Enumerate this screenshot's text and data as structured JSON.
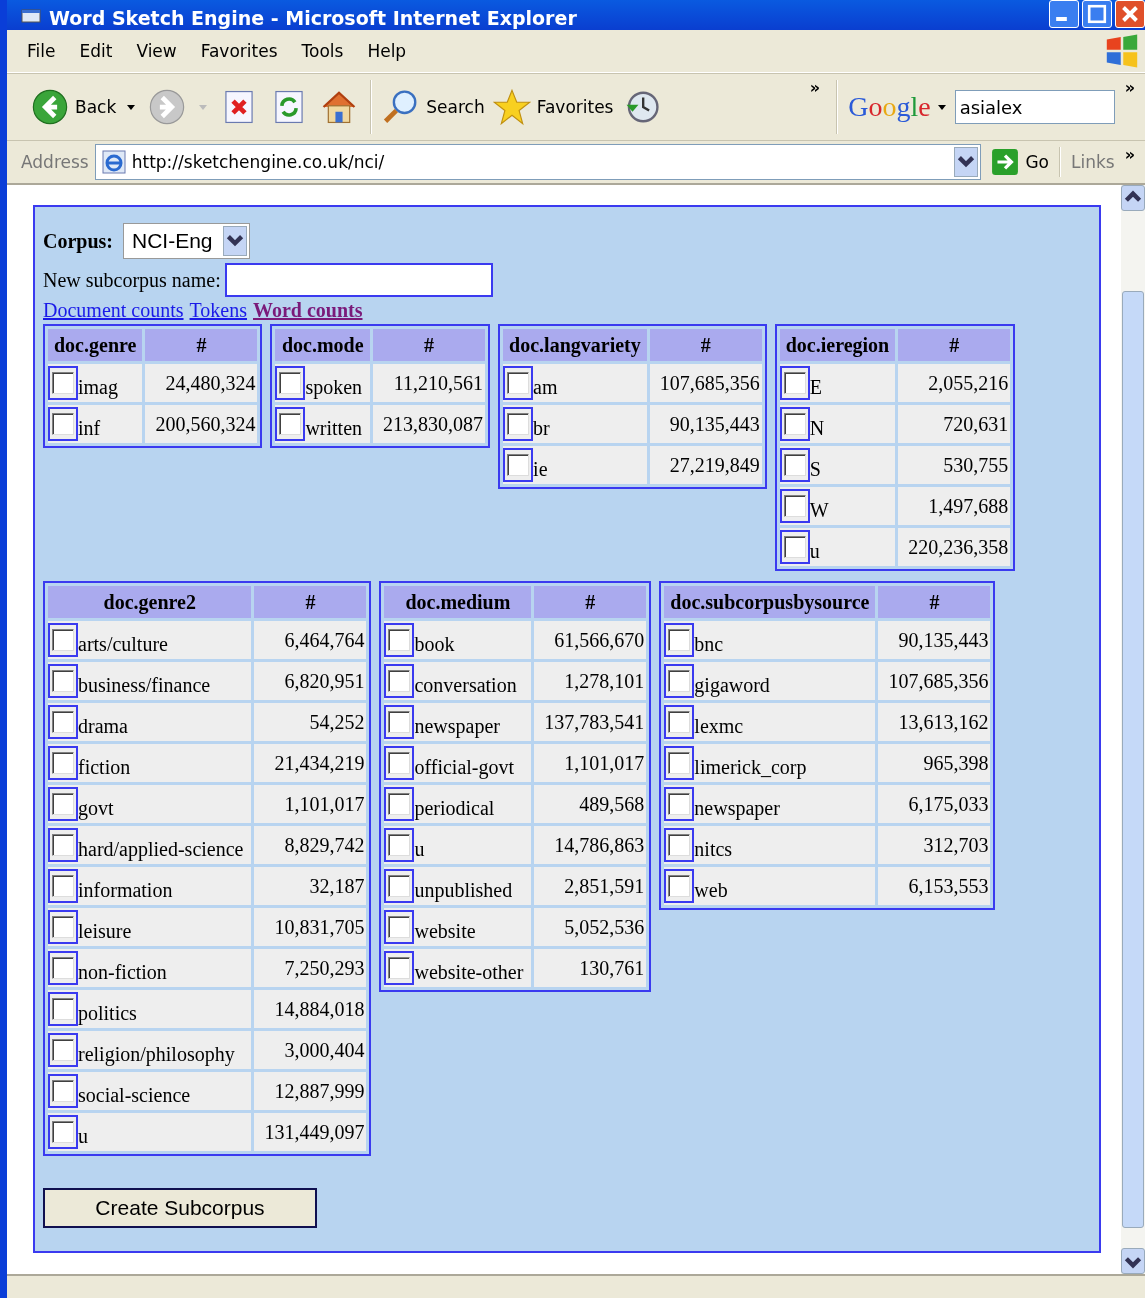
{
  "window": {
    "title": "Word Sketch Engine - Microsoft Internet Explorer"
  },
  "menu": [
    "File",
    "Edit",
    "View",
    "Favorites",
    "Tools",
    "Help"
  ],
  "toolbar": {
    "back": "Back",
    "search": "Search",
    "favorites": "Favorites",
    "overflow": "»",
    "google": "Google",
    "search_value": "asialex",
    "overflow_right": "»"
  },
  "address_bar": {
    "label": "Address",
    "url": "http://sketchengine.co.uk/nci/",
    "go": "Go",
    "links": "Links",
    "overflow": "»"
  },
  "form": {
    "corpus_label": "Corpus:",
    "corpus_value": "NCI-Eng",
    "name_label": "New subcorpus name:",
    "count_links": [
      {
        "label": "Document counts",
        "selected": false
      },
      {
        "label": "Tokens",
        "selected": false
      },
      {
        "label": "Word counts",
        "selected": true
      }
    ],
    "facet_rows": [
      [
        {
          "attribute": "doc.genre",
          "count_header": "#",
          "rows": [
            {
              "value": "imag",
              "count": "24,480,324",
              "checked": false
            },
            {
              "value": "inf",
              "count": "200,560,324",
              "checked": false
            }
          ]
        },
        {
          "attribute": "doc.mode",
          "count_header": "#",
          "rows": [
            {
              "value": "spoken",
              "count": "11,210,561",
              "checked": false
            },
            {
              "value": "written",
              "count": "213,830,087",
              "checked": false
            }
          ]
        },
        {
          "attribute": "doc.langvariety",
          "count_header": "#",
          "rows": [
            {
              "value": "am",
              "count": "107,685,356",
              "checked": false
            },
            {
              "value": "br",
              "count": "90,135,443",
              "checked": false
            },
            {
              "value": "ie",
              "count": "27,219,849",
              "checked": false
            }
          ]
        },
        {
          "attribute": "doc.ieregion",
          "count_header": "#",
          "rows": [
            {
              "value": "E",
              "count": "2,055,216",
              "checked": false
            },
            {
              "value": "N",
              "count": "720,631",
              "checked": false
            },
            {
              "value": "S",
              "count": "530,755",
              "checked": false
            },
            {
              "value": "W",
              "count": "1,497,688",
              "checked": false
            },
            {
              "value": "u",
              "count": "220,236,358",
              "checked": false
            }
          ]
        }
      ],
      [
        {
          "attribute": "doc.genre2",
          "count_header": "#",
          "rows": [
            {
              "value": "arts/culture",
              "count": "6,464,764",
              "checked": false
            },
            {
              "value": "business/finance",
              "count": "6,820,951",
              "checked": false
            },
            {
              "value": "drama",
              "count": "54,252",
              "checked": false
            },
            {
              "value": "fiction",
              "count": "21,434,219",
              "checked": false
            },
            {
              "value": "govt",
              "count": "1,101,017",
              "checked": false
            },
            {
              "value": "hard/applied-science",
              "count": "8,829,742",
              "checked": false
            },
            {
              "value": "information",
              "count": "32,187",
              "checked": false
            },
            {
              "value": "leisure",
              "count": "10,831,705",
              "checked": false
            },
            {
              "value": "non-fiction",
              "count": "7,250,293",
              "checked": false
            },
            {
              "value": "politics",
              "count": "14,884,018",
              "checked": false
            },
            {
              "value": "religion/philosophy",
              "count": "3,000,404",
              "checked": false
            },
            {
              "value": "social-science",
              "count": "12,887,999",
              "checked": false
            },
            {
              "value": "u",
              "count": "131,449,097",
              "checked": false
            }
          ]
        },
        {
          "attribute": "doc.medium",
          "count_header": "#",
          "rows": [
            {
              "value": "book",
              "count": "61,566,670",
              "checked": false
            },
            {
              "value": "conversation",
              "count": "1,278,101",
              "checked": false
            },
            {
              "value": "newspaper",
              "count": "137,783,541",
              "checked": false
            },
            {
              "value": "official-govt",
              "count": "1,101,017",
              "checked": false
            },
            {
              "value": "periodical",
              "count": "489,568",
              "checked": false
            },
            {
              "value": "u",
              "count": "14,786,863",
              "checked": false
            },
            {
              "value": "unpublished",
              "count": "2,851,591",
              "checked": false
            },
            {
              "value": "website",
              "count": "5,052,536",
              "checked": false
            },
            {
              "value": "website-other",
              "count": "130,761",
              "checked": false
            }
          ]
        },
        {
          "attribute": "doc.subcorpusbysource",
          "count_header": "#",
          "rows": [
            {
              "value": "bnc",
              "count": "90,135,443",
              "checked": false
            },
            {
              "value": "gigaword",
              "count": "107,685,356",
              "checked": false
            },
            {
              "value": "lexmc",
              "count": "13,613,162",
              "checked": false
            },
            {
              "value": "limerick_corp",
              "count": "965,398",
              "checked": false
            },
            {
              "value": "newspaper",
              "count": "6,175,033",
              "checked": false
            },
            {
              "value": "nitcs",
              "count": "312,703",
              "checked": false
            },
            {
              "value": "web",
              "count": "6,153,553",
              "checked": false
            }
          ]
        }
      ]
    ],
    "submit": "Create Subcorpus"
  }
}
